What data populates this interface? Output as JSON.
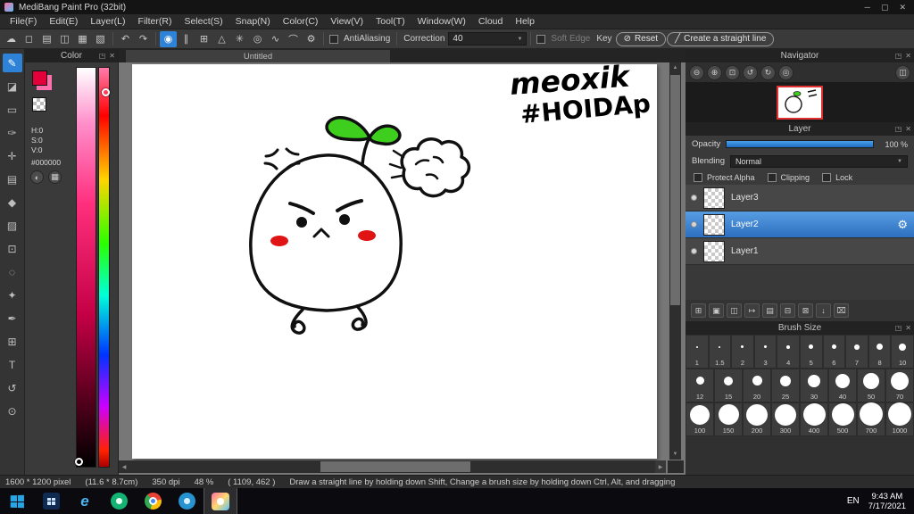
{
  "colors": {
    "accent_blue": "#2e83d8",
    "leaf_green": "#3ecf1e",
    "blush_red": "#e01414",
    "selection_red": "#e03030",
    "swatch_red": "#e3003a"
  },
  "titlebar": {
    "title": "MediBang Paint Pro (32bit)"
  },
  "icons": {
    "minimize": "─",
    "maximize": "▢",
    "close": "✕",
    "popup": "◳",
    "panel_close": "✕",
    "caret_down": "▼",
    "reset": "⊘",
    "straight_line": "╱",
    "gear": "⚙",
    "undo": "↶",
    "redo": "↷"
  },
  "menu": {
    "items": [
      "File(F)",
      "Edit(E)",
      "Layer(L)",
      "Filter(R)",
      "Select(S)",
      "Snap(N)",
      "Color(C)",
      "View(V)",
      "Tool(T)",
      "Window(W)",
      "Cloud",
      "Help"
    ]
  },
  "toolbar": {
    "file_icons": [
      {
        "name": "cloud",
        "glyph": "☁"
      },
      {
        "name": "new-canvas",
        "glyph": "◻"
      },
      {
        "name": "open-file",
        "glyph": "▤"
      },
      {
        "name": "save",
        "glyph": "◫"
      },
      {
        "name": "grid-view",
        "glyph": "▦"
      },
      {
        "name": "panel-layout",
        "glyph": "▧"
      }
    ],
    "snap_icons": [
      {
        "name": "snap-off",
        "glyph": "◉"
      },
      {
        "name": "snap-parallel",
        "glyph": "∥"
      },
      {
        "name": "snap-cross",
        "glyph": "⊞"
      },
      {
        "name": "snap-vanishing",
        "glyph": "△"
      },
      {
        "name": "snap-radial",
        "glyph": "✳"
      },
      {
        "name": "snap-circle",
        "glyph": "◎"
      },
      {
        "name": "snap-curve",
        "glyph": "∿"
      },
      {
        "name": "snap-guide",
        "glyph": "⌒"
      },
      {
        "name": "snap-settings",
        "glyph": "⚙"
      }
    ],
    "antialiasing_label": "AntiAliasing",
    "correction_label": "Correction",
    "correction_value": "40",
    "soft_edge_label": "Soft Edge",
    "key_label": "Key",
    "reset_label": "Reset",
    "straight_line_label": "Create a straight line"
  },
  "tool_strip": {
    "tools": [
      {
        "name": "pen",
        "glyph": "✎"
      },
      {
        "name": "eraser",
        "glyph": "◪"
      },
      {
        "name": "marquee",
        "glyph": "▭"
      },
      {
        "name": "brush",
        "glyph": "✑"
      },
      {
        "name": "move",
        "glyph": "✛"
      },
      {
        "name": "divide",
        "glyph": "▤"
      },
      {
        "name": "bucket",
        "glyph": "◆"
      },
      {
        "name": "gradient",
        "glyph": "▨"
      },
      {
        "name": "select-rect",
        "glyph": "⊡"
      },
      {
        "name": "lasso",
        "glyph": "◌"
      },
      {
        "name": "magic-wand",
        "glyph": "✦"
      },
      {
        "name": "select-pen",
        "glyph": "✒"
      },
      {
        "name": "grid",
        "glyph": "⊞"
      },
      {
        "name": "text",
        "glyph": "T"
      },
      {
        "name": "rotate",
        "glyph": "↺"
      },
      {
        "name": "eyedropper",
        "glyph": "⊙"
      }
    ]
  },
  "color_panel": {
    "title": "Color",
    "h": "H:0",
    "s": "S:0",
    "v": "V:0",
    "hex": "#000000",
    "buttons": [
      {
        "name": "color-wheel",
        "glyph": "◐"
      },
      {
        "name": "palette",
        "glyph": "▦"
      }
    ]
  },
  "canvas": {
    "tab": "Untitled",
    "annotation_line1": "meoxik",
    "annotation_line2": "#HOIDAp"
  },
  "navigator": {
    "title": "Navigator",
    "buttons": [
      {
        "name": "zoom-out",
        "glyph": "⊖"
      },
      {
        "name": "zoom-in",
        "glyph": "⊕"
      },
      {
        "name": "zoom-fit",
        "glyph": "⊡"
      },
      {
        "name": "rotate-ccw",
        "glyph": "↺"
      },
      {
        "name": "rotate-cw",
        "glyph": "↻"
      },
      {
        "name": "reset-view",
        "glyph": "◎"
      },
      {
        "name": "flip-view",
        "glyph": "◫"
      }
    ]
  },
  "layer_panel": {
    "title": "Layer",
    "opacity_label": "Opacity",
    "opacity_value": "100 %",
    "blending_label": "Blending",
    "blending_value": "Normal",
    "protect_alpha_label": "Protect Alpha",
    "clipping_label": "Clipping",
    "lock_label": "Lock",
    "layers": [
      {
        "name": "Layer3"
      },
      {
        "name": "Layer2"
      },
      {
        "name": "Layer1"
      }
    ],
    "action_buttons": [
      {
        "name": "add-layer",
        "glyph": "⊞"
      },
      {
        "name": "add-folder",
        "glyph": "▣"
      },
      {
        "name": "duplicate-layer",
        "glyph": "◫"
      },
      {
        "name": "transfer-layer",
        "glyph": "↦"
      },
      {
        "name": "layer-folder",
        "glyph": "▤"
      },
      {
        "name": "merge-layer",
        "glyph": "⊟"
      },
      {
        "name": "copy-layer",
        "glyph": "⊠"
      },
      {
        "name": "move-layer-down",
        "glyph": "↓"
      },
      {
        "name": "delete-layer",
        "glyph": "⌧"
      }
    ]
  },
  "brush_panel": {
    "title": "Brush Size",
    "sizes": [
      "1",
      "1.5",
      "2",
      "3",
      "4",
      "5",
      "6",
      "7",
      "8",
      "10",
      "12",
      "15",
      "20",
      "25",
      "30",
      "40",
      "50",
      "70",
      "100",
      "150",
      "200",
      "300",
      "400",
      "500",
      "700",
      "1000"
    ]
  },
  "status_bar": {
    "dimensions": "1600 * 1200 pixel",
    "size_cm": "(11.6 * 8.7cm)",
    "dpi": "350 dpi",
    "zoom": "48 %",
    "coords": "( 1109, 462 )",
    "hint": "Draw a straight line by holding down Shift, Change a brush size by holding down Ctrl, Alt, and dragging"
  },
  "taskbar": {
    "language": "EN",
    "time": "9:43 AM",
    "date": "7/17/2021"
  }
}
